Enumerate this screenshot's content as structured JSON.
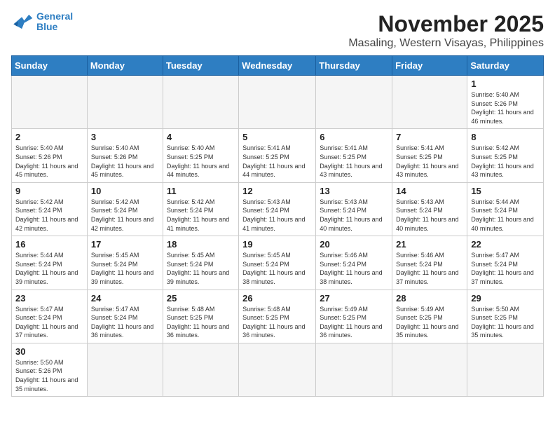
{
  "header": {
    "logo_general": "General",
    "logo_blue": "Blue",
    "month_title": "November 2025",
    "location": "Masaling, Western Visayas, Philippines"
  },
  "weekdays": [
    "Sunday",
    "Monday",
    "Tuesday",
    "Wednesday",
    "Thursday",
    "Friday",
    "Saturday"
  ],
  "days": {
    "1": {
      "sunrise": "5:40 AM",
      "sunset": "5:26 PM",
      "daylight": "11 hours and 46 minutes."
    },
    "2": {
      "sunrise": "5:40 AM",
      "sunset": "5:26 PM",
      "daylight": "11 hours and 45 minutes."
    },
    "3": {
      "sunrise": "5:40 AM",
      "sunset": "5:26 PM",
      "daylight": "11 hours and 45 minutes."
    },
    "4": {
      "sunrise": "5:40 AM",
      "sunset": "5:25 PM",
      "daylight": "11 hours and 44 minutes."
    },
    "5": {
      "sunrise": "5:41 AM",
      "sunset": "5:25 PM",
      "daylight": "11 hours and 44 minutes."
    },
    "6": {
      "sunrise": "5:41 AM",
      "sunset": "5:25 PM",
      "daylight": "11 hours and 43 minutes."
    },
    "7": {
      "sunrise": "5:41 AM",
      "sunset": "5:25 PM",
      "daylight": "11 hours and 43 minutes."
    },
    "8": {
      "sunrise": "5:42 AM",
      "sunset": "5:25 PM",
      "daylight": "11 hours and 43 minutes."
    },
    "9": {
      "sunrise": "5:42 AM",
      "sunset": "5:24 PM",
      "daylight": "11 hours and 42 minutes."
    },
    "10": {
      "sunrise": "5:42 AM",
      "sunset": "5:24 PM",
      "daylight": "11 hours and 42 minutes."
    },
    "11": {
      "sunrise": "5:42 AM",
      "sunset": "5:24 PM",
      "daylight": "11 hours and 41 minutes."
    },
    "12": {
      "sunrise": "5:43 AM",
      "sunset": "5:24 PM",
      "daylight": "11 hours and 41 minutes."
    },
    "13": {
      "sunrise": "5:43 AM",
      "sunset": "5:24 PM",
      "daylight": "11 hours and 40 minutes."
    },
    "14": {
      "sunrise": "5:43 AM",
      "sunset": "5:24 PM",
      "daylight": "11 hours and 40 minutes."
    },
    "15": {
      "sunrise": "5:44 AM",
      "sunset": "5:24 PM",
      "daylight": "11 hours and 40 minutes."
    },
    "16": {
      "sunrise": "5:44 AM",
      "sunset": "5:24 PM",
      "daylight": "11 hours and 39 minutes."
    },
    "17": {
      "sunrise": "5:45 AM",
      "sunset": "5:24 PM",
      "daylight": "11 hours and 39 minutes."
    },
    "18": {
      "sunrise": "5:45 AM",
      "sunset": "5:24 PM",
      "daylight": "11 hours and 39 minutes."
    },
    "19": {
      "sunrise": "5:45 AM",
      "sunset": "5:24 PM",
      "daylight": "11 hours and 38 minutes."
    },
    "20": {
      "sunrise": "5:46 AM",
      "sunset": "5:24 PM",
      "daylight": "11 hours and 38 minutes."
    },
    "21": {
      "sunrise": "5:46 AM",
      "sunset": "5:24 PM",
      "daylight": "11 hours and 37 minutes."
    },
    "22": {
      "sunrise": "5:47 AM",
      "sunset": "5:24 PM",
      "daylight": "11 hours and 37 minutes."
    },
    "23": {
      "sunrise": "5:47 AM",
      "sunset": "5:24 PM",
      "daylight": "11 hours and 37 minutes."
    },
    "24": {
      "sunrise": "5:47 AM",
      "sunset": "5:24 PM",
      "daylight": "11 hours and 36 minutes."
    },
    "25": {
      "sunrise": "5:48 AM",
      "sunset": "5:25 PM",
      "daylight": "11 hours and 36 minutes."
    },
    "26": {
      "sunrise": "5:48 AM",
      "sunset": "5:25 PM",
      "daylight": "11 hours and 36 minutes."
    },
    "27": {
      "sunrise": "5:49 AM",
      "sunset": "5:25 PM",
      "daylight": "11 hours and 36 minutes."
    },
    "28": {
      "sunrise": "5:49 AM",
      "sunset": "5:25 PM",
      "daylight": "11 hours and 35 minutes."
    },
    "29": {
      "sunrise": "5:50 AM",
      "sunset": "5:25 PM",
      "daylight": "11 hours and 35 minutes."
    },
    "30": {
      "sunrise": "5:50 AM",
      "sunset": "5:26 PM",
      "daylight": "11 hours and 35 minutes."
    }
  },
  "labels": {
    "sunrise": "Sunrise:",
    "sunset": "Sunset:",
    "daylight": "Daylight:"
  }
}
